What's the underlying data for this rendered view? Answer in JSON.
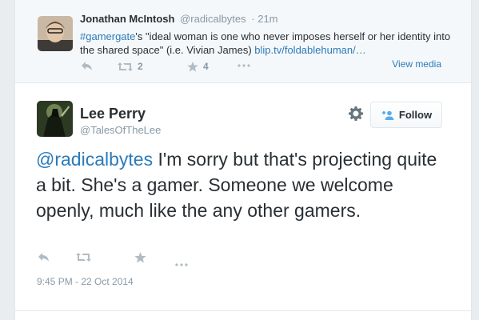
{
  "parent_tweet": {
    "name": "Jonathan McIntosh",
    "handle": "@radicalbytes",
    "time": "· 21m",
    "hashtag": "#gamergate",
    "text": "'s \"ideal woman is one who never imposes herself or her identity into the shared space\" (i.e. Vivian James) ",
    "link": "blip.tv/foldablehuman/…",
    "retweet_count": "2",
    "favorite_count": "4",
    "view_media_label": "View media"
  },
  "tweet": {
    "name": "Lee Perry",
    "handle": "@TalesOfTheLee",
    "mention": "@radicalbytes",
    "text": " I'm sorry but that's projecting quite a bit. She's a gamer. Someone we welcome openly, much like the any other gamers.",
    "follow_label": "Follow",
    "timestamp": "9:45 PM - 22 Oct 2014"
  },
  "icons": {
    "reply": "reply-icon",
    "retweet": "retweet-icon",
    "favorite": "star-icon",
    "more": "more-icon",
    "settings": "gear-icon",
    "follow": "add-user-icon"
  },
  "colors": {
    "link": "#2b7bb9",
    "muted": "#8899a6",
    "text": "#292f33"
  }
}
